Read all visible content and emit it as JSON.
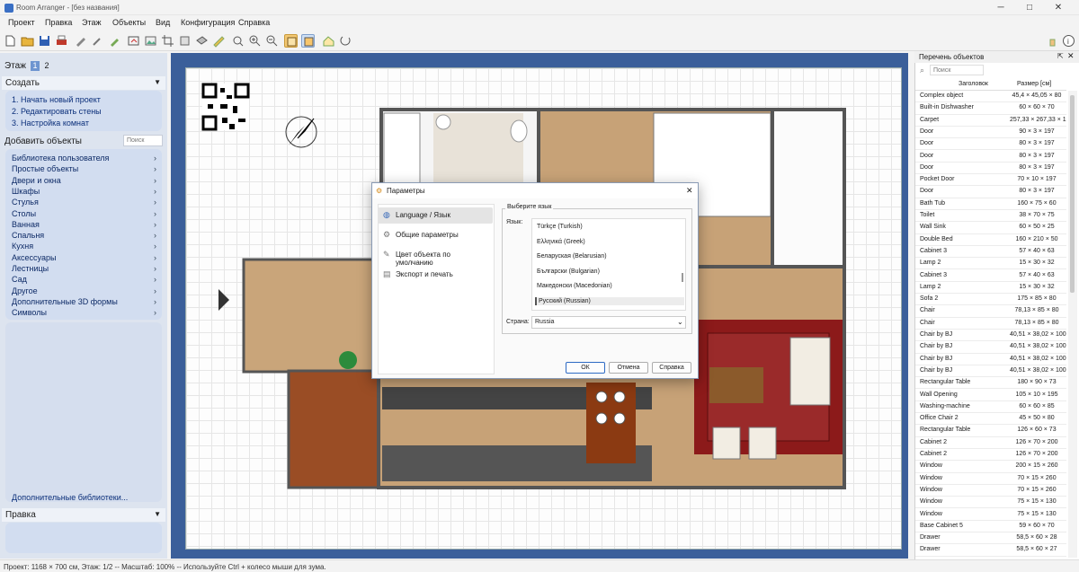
{
  "window": {
    "title": "Room Arranger - [без названия]",
    "minimize": "─",
    "maximize": "□",
    "close": "✕"
  },
  "menu": [
    "Проект",
    "Правка",
    "Этаж",
    "Объекты",
    "Вид",
    "Конфигурация",
    "Справка"
  ],
  "toolbar": {
    "icons": [
      "new-file-icon",
      "open-folder-icon",
      "save-icon",
      "print-icon",
      "paint-icon",
      "wrench-icon",
      "brush-icon",
      "export-icon",
      "image-icon",
      "crop-icon",
      "redo-icon",
      "layers-icon",
      "move-icon",
      "ruler-icon",
      "zoom-fit-icon",
      "zoom-in-icon",
      "zoom-out-icon",
      "view-2d-icon",
      "view-3d-icon",
      "house-icon",
      "rotate-icon"
    ],
    "right_icons": [
      "hand-icon",
      "info-icon"
    ]
  },
  "left": {
    "floor_label": "Этаж",
    "floor_tabs": [
      "1",
      "2"
    ],
    "create_header": "Создать",
    "create_items": [
      "1. Начать новый проект",
      "2. Редактировать стены",
      "3. Настройка комнат"
    ],
    "add_header": "Добавить объекты",
    "search_placeholder": "Поиск",
    "categories": [
      "Библиотека пользователя",
      "Простые объекты",
      "Двери и окна",
      "Шкафы",
      "Стулья",
      "Столы",
      "Ванная",
      "Спальня",
      "Кухня",
      "Аксессуары",
      "Лестницы",
      "Сад",
      "Другое",
      "Дополнительные 3D формы",
      "Символы"
    ],
    "more_libraries": "Дополнительные библиотеки...",
    "edit_header": "Правка"
  },
  "objects_panel": {
    "title": "Перечень объектов",
    "search_placeholder": "Поиск",
    "col_title": "Заголовок",
    "col_size": "Размер [см]",
    "rows": [
      [
        "Complex object",
        "45,4 × 45,05 × 80"
      ],
      [
        "Built-in Dishwasher",
        "60 × 60 × 70"
      ],
      [
        "Carpet",
        "257,33 × 267,33 × 1"
      ],
      [
        "Door",
        "90 × 3 × 197"
      ],
      [
        "Door",
        "80 × 3 × 197"
      ],
      [
        "Door",
        "80 × 3 × 197"
      ],
      [
        "Door",
        "80 × 3 × 197"
      ],
      [
        "Pocket Door",
        "70 × 10 × 197"
      ],
      [
        "Door",
        "80 × 3 × 197"
      ],
      [
        "Bath Tub",
        "160 × 75 × 60"
      ],
      [
        "Toilet",
        "38 × 70 × 75"
      ],
      [
        "Wall Sink",
        "60 × 50 × 25"
      ],
      [
        "Double Bed",
        "160 × 210 × 50"
      ],
      [
        "Cabinet 3",
        "57 × 40 × 63"
      ],
      [
        "Lamp 2",
        "15 × 30 × 32"
      ],
      [
        "Cabinet 3",
        "57 × 40 × 63"
      ],
      [
        "Lamp 2",
        "15 × 30 × 32"
      ],
      [
        "Sofa 2",
        "175 × 85 × 80"
      ],
      [
        "Chair",
        "78,13 × 85 × 80"
      ],
      [
        "Chair",
        "78,13 × 85 × 80"
      ],
      [
        "Chair by BJ",
        "40,51 × 38,02 × 100"
      ],
      [
        "Chair by BJ",
        "40,51 × 38,02 × 100"
      ],
      [
        "Chair by BJ",
        "40,51 × 38,02 × 100"
      ],
      [
        "Chair by BJ",
        "40,51 × 38,02 × 100"
      ],
      [
        "Rectangular Table",
        "180 × 90 × 73"
      ],
      [
        "Wall Opening",
        "105 × 10 × 195"
      ],
      [
        "Washing-machine",
        "60 × 60 × 85"
      ],
      [
        "Office Chair 2",
        "45 × 50 × 80"
      ],
      [
        "Rectangular Table",
        "126 × 60 × 73"
      ],
      [
        "Cabinet 2",
        "126 × 70 × 200"
      ],
      [
        "Cabinet 2",
        "126 × 70 × 200"
      ],
      [
        "Window",
        "200 × 15 × 260"
      ],
      [
        "Window",
        "70 × 15 × 260"
      ],
      [
        "Window",
        "70 × 15 × 260"
      ],
      [
        "Window",
        "75 × 15 × 130"
      ],
      [
        "Window",
        "75 × 15 × 130"
      ],
      [
        "Base Cabinet 5",
        "59 × 60 × 70"
      ],
      [
        "Drawer",
        "58,5 × 60 × 28"
      ],
      [
        "Drawer",
        "58,5 × 60 × 27"
      ]
    ]
  },
  "status": "Проект: 1168 × 700 см, Этаж: 1/2 -- Масштаб: 100% -- Используйте Ctrl + колесо мыши для зума.",
  "dialog": {
    "title": "Параметры",
    "nav": [
      "Language / Язык",
      "Общие параметры",
      "Цвет объекта по умолчанию",
      "Экспорт и печать"
    ],
    "group_title": "Выберите язык",
    "lang_label": "Язык:",
    "languages": [
      "Türkçe (Turkish)",
      "Ελληνικά (Greek)",
      "Беларуская (Belarusian)",
      "Български (Bulgarian)",
      "Македонски (Macedonian)",
      "Русский (Russian)"
    ],
    "selected_language": "Русский (Russian)",
    "country_label": "Страна:",
    "country_value": "Russia",
    "ok": "ОК",
    "cancel": "Отмена",
    "help": "Справка"
  }
}
